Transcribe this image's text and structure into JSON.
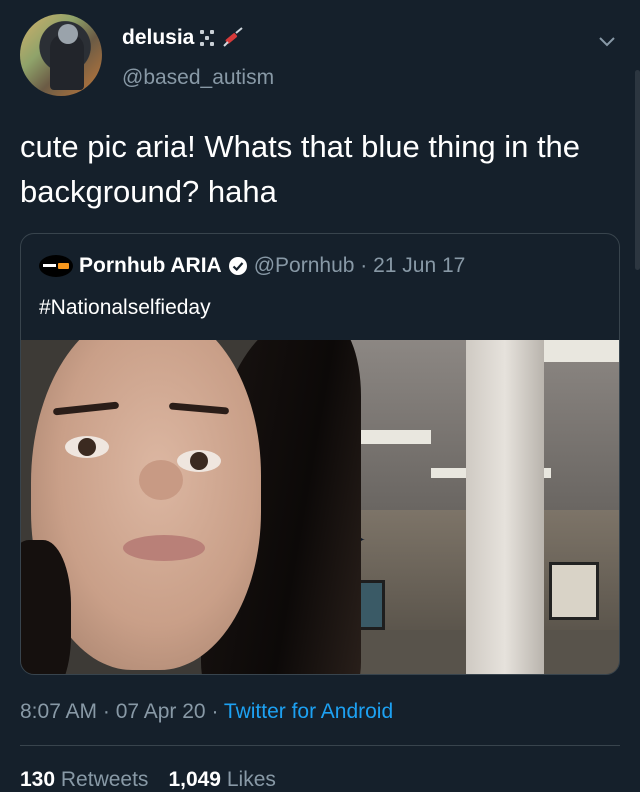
{
  "author": {
    "display_name": "delusia",
    "handle": "@based_autism",
    "avatar_icon": "avatar-photo",
    "name_emojis": [
      "dice-emoji-icon",
      "syringe-emoji-icon"
    ]
  },
  "tweet": {
    "text": "cute pic aria!  Whats that blue thing in the background?  haha"
  },
  "quoted_tweet": {
    "display_name": "Pornhub ARIA",
    "handle_date": "@Pornhub · 21 Jun 17",
    "text": "#Nationalselfieday",
    "verified": true
  },
  "meta": {
    "time_date": "8:07 AM · 07 Apr 20 · ",
    "client": "Twitter for Android"
  },
  "stats": {
    "retweets_count": "130",
    "retweets_label": "Retweets",
    "likes_count": "1,049",
    "likes_label": "Likes"
  },
  "colors": {
    "background": "#15202b",
    "secondary_text": "#8899a6",
    "link": "#1da1f2",
    "border": "#38444d"
  }
}
